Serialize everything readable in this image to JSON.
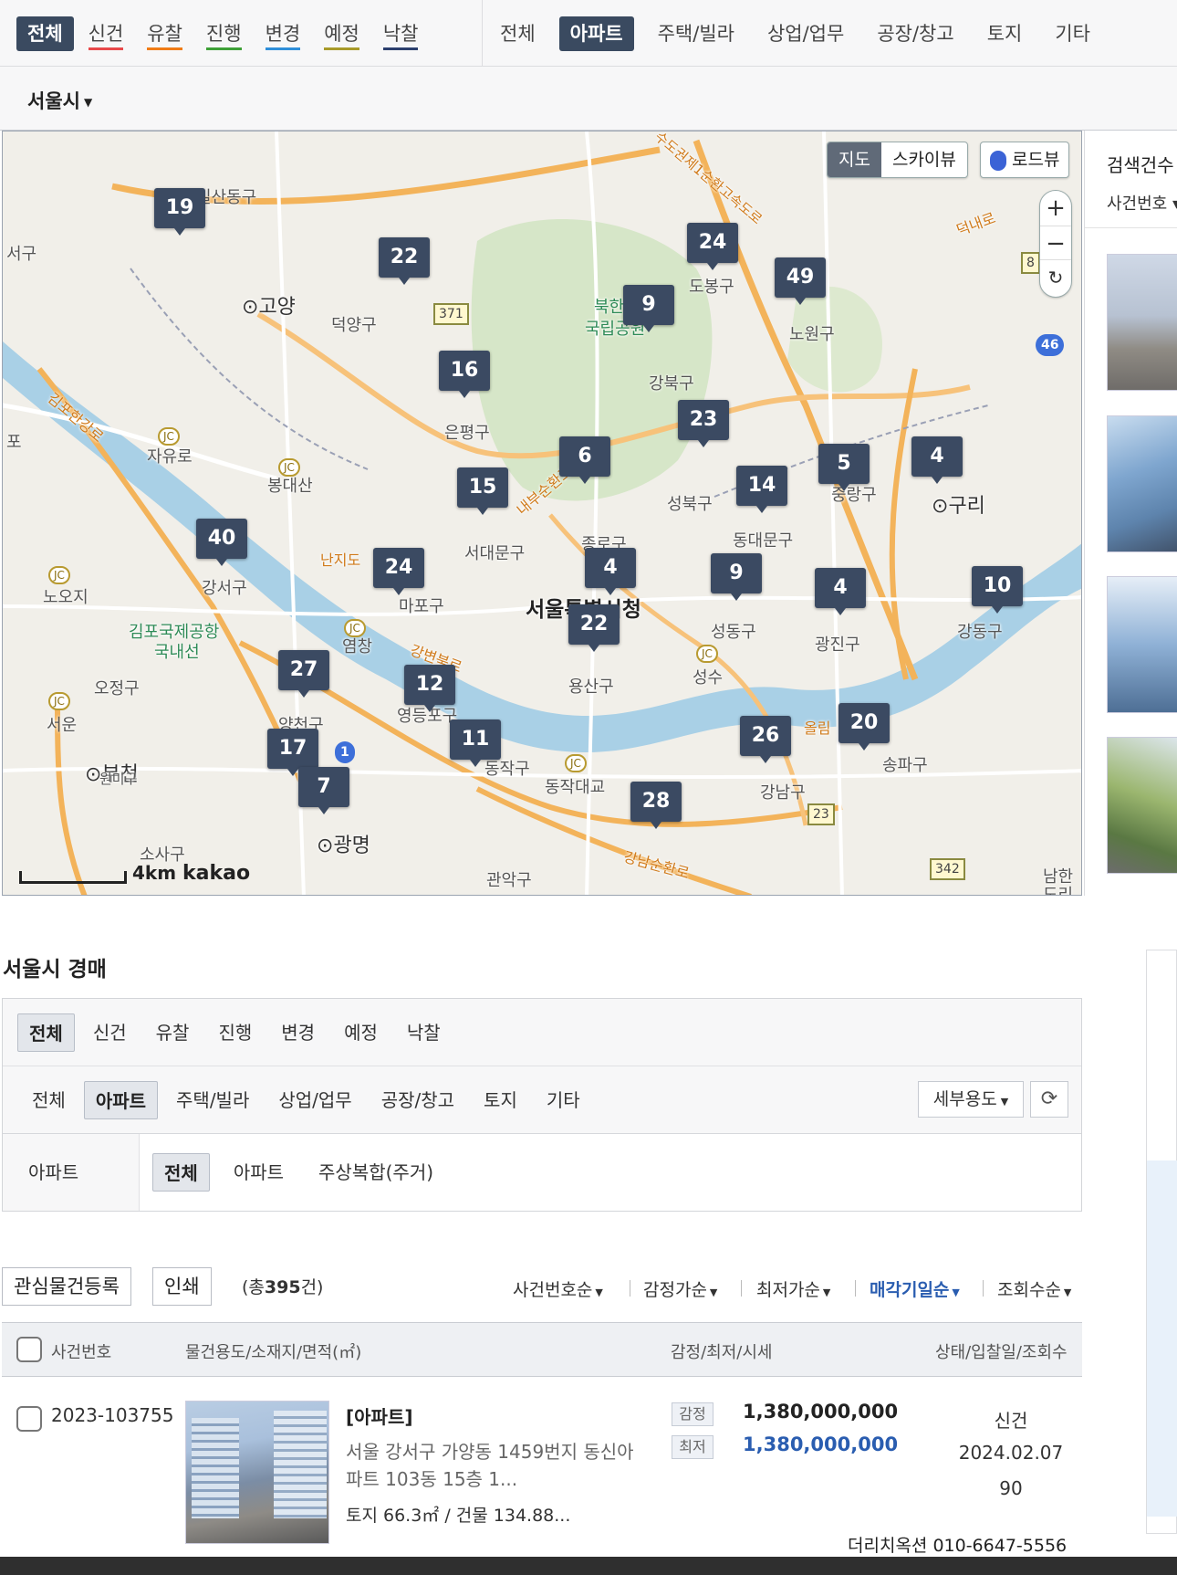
{
  "status_tabs": [
    {
      "label": "전체",
      "color": ""
    },
    {
      "label": "신건",
      "color": "#e8494b"
    },
    {
      "label": "유찰",
      "color": "#f07c16"
    },
    {
      "label": "진행",
      "color": "#3ea038"
    },
    {
      "label": "변경",
      "color": "#2f8fd9"
    },
    {
      "label": "예정",
      "color": "#a89a2a"
    },
    {
      "label": "낙찰",
      "color": "#2c3f6e"
    }
  ],
  "type_tabs": [
    "전체",
    "아파트",
    "주택/빌라",
    "상업/업무",
    "공장/창고",
    "토지",
    "기타"
  ],
  "region": "서울시",
  "map": {
    "type_buttons": [
      "지도",
      "스카이뷰"
    ],
    "roadview": "로드뷰",
    "zoom_in": "+",
    "zoom_out": "−",
    "reset": "↻",
    "scale": "4km",
    "brand": "kakao",
    "center_label": "서울특별시청",
    "pins": [
      "19",
      "22",
      "24",
      "49",
      "9",
      "16",
      "23",
      "6",
      "5",
      "4",
      "14",
      "15",
      "40",
      "24",
      "4",
      "9",
      "4",
      "10",
      "22",
      "27",
      "12",
      "20",
      "26",
      "11",
      "17",
      "7",
      "28"
    ],
    "labels": {
      "ilsandonggu": "일산동구",
      "seogu": "서구",
      "goyang": "고양",
      "deogyanggu": "덕양구",
      "bukhan": "북한",
      "gungnip": "국립공원",
      "dobonggu": "도봉구",
      "nowongu": "노원구",
      "gangbukgu": "강북구",
      "eunpyeonggu": "은평구",
      "jayuro": "자유로",
      "bongdaesan": "봉대산",
      "seongbukgu": "성북구",
      "jungnanggu": "중랑구",
      "guri": "구리",
      "dongdaemungu": "동대문구",
      "jongnogu": "종로구",
      "seodaemungu": "서대문구",
      "nanjido": "난지도",
      "mapogu": "마포구",
      "gangseogu": "강서구",
      "noosanji": "노오지",
      "gimpo": "김포국제공항",
      "gungnaeseon": "국내선",
      "yeomchang": "염창",
      "seongdonggu": "성동구",
      "gwangjingu": "광진구",
      "gangdonggu": "강동구",
      "yongsangu": "용산구",
      "seongsu": "성수",
      "ojeonggu": "오정구",
      "seowoon": "서운",
      "yangcheongu": "양천구",
      "yeongdeungpogu": "영등포구",
      "dongjakgu": "동작구",
      "dongjakdaegyo": "동작대교",
      "gangnamgu": "강남구",
      "songpagu": "송파구",
      "bucheon": "부천",
      "wonmigu": "원미구",
      "gwangmyeong": "광명",
      "sosagu": "소사구",
      "gwanakgu": "관악구",
      "namhansan": "남한",
      "doribeon": "도리",
      "po": "포",
      "gimpohangang": "김포한강로",
      "naebusunhwan": "내부순환로",
      "gangbyeonbuk": "강변북로",
      "olympic": "올림",
      "gangnamsunhwan": "강남순환로",
      "deongnaero": "덕내로",
      "sudogwon": "수도권제1순환고속도로"
    },
    "routes": {
      "r371": "371",
      "r8": "8",
      "r46": "46",
      "r1": "1",
      "r23": "23",
      "r342": "342"
    }
  },
  "right_panel": {
    "count_label": "검색건수",
    "sort_label": "사건번호"
  },
  "section_title": "서울시 경매",
  "filter": {
    "status": [
      "전체",
      "신건",
      "유찰",
      "진행",
      "변경",
      "예정",
      "낙찰"
    ],
    "types": [
      "전체",
      "아파트",
      "주택/빌라",
      "상업/업무",
      "공장/창고",
      "토지",
      "기타"
    ],
    "sub_label": "아파트",
    "sub_types": [
      "전체",
      "아파트",
      "주상복합(주거)"
    ],
    "sub_use": "세부용도"
  },
  "actions": {
    "watch": "관심물건등록",
    "print": "인쇄",
    "total_prefix": "(총",
    "total_count": "395",
    "total_suffix": "건)"
  },
  "sorts": [
    "사건번호순",
    "감정가순",
    "최저가순",
    "매각기일순",
    "조회수순"
  ],
  "table": {
    "headers": {
      "case": "사건번호",
      "property": "물건용도/소재지/면적(㎡)",
      "price": "감정/최저/시세",
      "status": "상태/입찰일/조회수"
    },
    "rows": [
      {
        "case_no": "2023-103755",
        "type": "[아파트]",
        "address": "서울 강서구 가양동 1459번지 동신아파트 103동 15층 1...",
        "area": "토지 66.3㎡ / 건물 134.88...",
        "appraisal_label": "감정",
        "appraisal": "1,380,000,000",
        "minimum_label": "최저",
        "minimum": "1,380,000,000",
        "status": "신건",
        "date": "2024.02.07",
        "views": "90",
        "contact": "더리치옥션 010-6647-5556"
      }
    ]
  }
}
